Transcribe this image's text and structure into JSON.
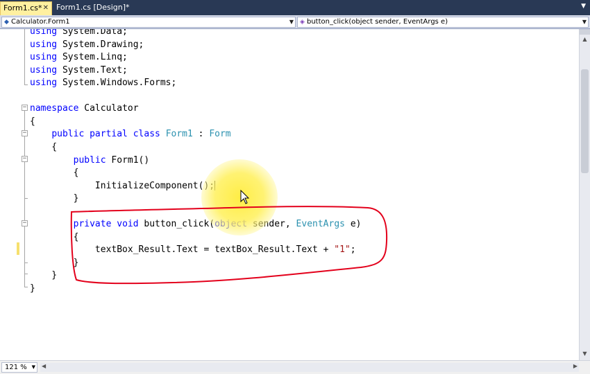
{
  "tabs": [
    {
      "label": "Form1.cs*",
      "active": true
    },
    {
      "label": "Form1.cs [Design]*",
      "active": false
    }
  ],
  "navigation": {
    "class_combo": "Calculator.Form1",
    "member_combo": "button_click(object sender, EventArgs e)"
  },
  "code_lines": [
    {
      "segments": [
        [
          "kw",
          "using"
        ],
        [
          "pl",
          " System.Data;"
        ]
      ]
    },
    {
      "segments": [
        [
          "kw",
          "using"
        ],
        [
          "pl",
          " System.Drawing;"
        ]
      ]
    },
    {
      "segments": [
        [
          "kw",
          "using"
        ],
        [
          "pl",
          " System.Linq;"
        ]
      ]
    },
    {
      "segments": [
        [
          "kw",
          "using"
        ],
        [
          "pl",
          " System.Text;"
        ]
      ]
    },
    {
      "segments": [
        [
          "kw",
          "using"
        ],
        [
          "pl",
          " System.Windows.Forms;"
        ]
      ]
    },
    {
      "segments": []
    },
    {
      "segments": [
        [
          "kw",
          "namespace"
        ],
        [
          "pl",
          " Calculator"
        ]
      ]
    },
    {
      "segments": [
        [
          "pl",
          "{"
        ]
      ]
    },
    {
      "segments": [
        [
          "pl",
          "    "
        ],
        [
          "kw",
          "public partial class"
        ],
        [
          "pl",
          " "
        ],
        [
          "ty",
          "Form1"
        ],
        [
          "pl",
          " : "
        ],
        [
          "ty",
          "Form"
        ]
      ]
    },
    {
      "segments": [
        [
          "pl",
          "    {"
        ]
      ]
    },
    {
      "segments": [
        [
          "pl",
          "        "
        ],
        [
          "kw",
          "public"
        ],
        [
          "pl",
          " Form1()"
        ]
      ]
    },
    {
      "segments": [
        [
          "pl",
          "        {"
        ]
      ]
    },
    {
      "segments": [
        [
          "pl",
          "            InitializeComponent();"
        ]
      ],
      "caret": true
    },
    {
      "segments": [
        [
          "pl",
          "        }"
        ]
      ]
    },
    {
      "segments": []
    },
    {
      "segments": [
        [
          "pl",
          "        "
        ],
        [
          "kw",
          "private void"
        ],
        [
          "pl",
          " button_click("
        ],
        [
          "kw",
          "object"
        ],
        [
          "pl",
          " sender, "
        ],
        [
          "ty",
          "EventArgs"
        ],
        [
          "pl",
          " e)"
        ]
      ]
    },
    {
      "segments": [
        [
          "pl",
          "        {"
        ]
      ]
    },
    {
      "segments": [
        [
          "pl",
          "            textBox_Result.Text = textBox_Result.Text + "
        ],
        [
          "st",
          "\"1\""
        ],
        [
          "pl",
          ";"
        ]
      ]
    },
    {
      "segments": [
        [
          "pl",
          "        }"
        ]
      ]
    },
    {
      "segments": [
        [
          "pl",
          "    }"
        ]
      ]
    },
    {
      "segments": [
        [
          "pl",
          "}"
        ]
      ]
    }
  ],
  "status": {
    "zoom": "121 %"
  },
  "colors": {
    "keyword": "#0000ff",
    "type": "#2b91af",
    "string": "#a31515",
    "annotation": "#e3001b",
    "active_tab": "#fff0a0",
    "tab_strip": "#293955"
  },
  "icons": [
    "close-icon",
    "dropdown-arrow-icon",
    "class-icon",
    "method-icon",
    "mouse-pointer-icon"
  ]
}
